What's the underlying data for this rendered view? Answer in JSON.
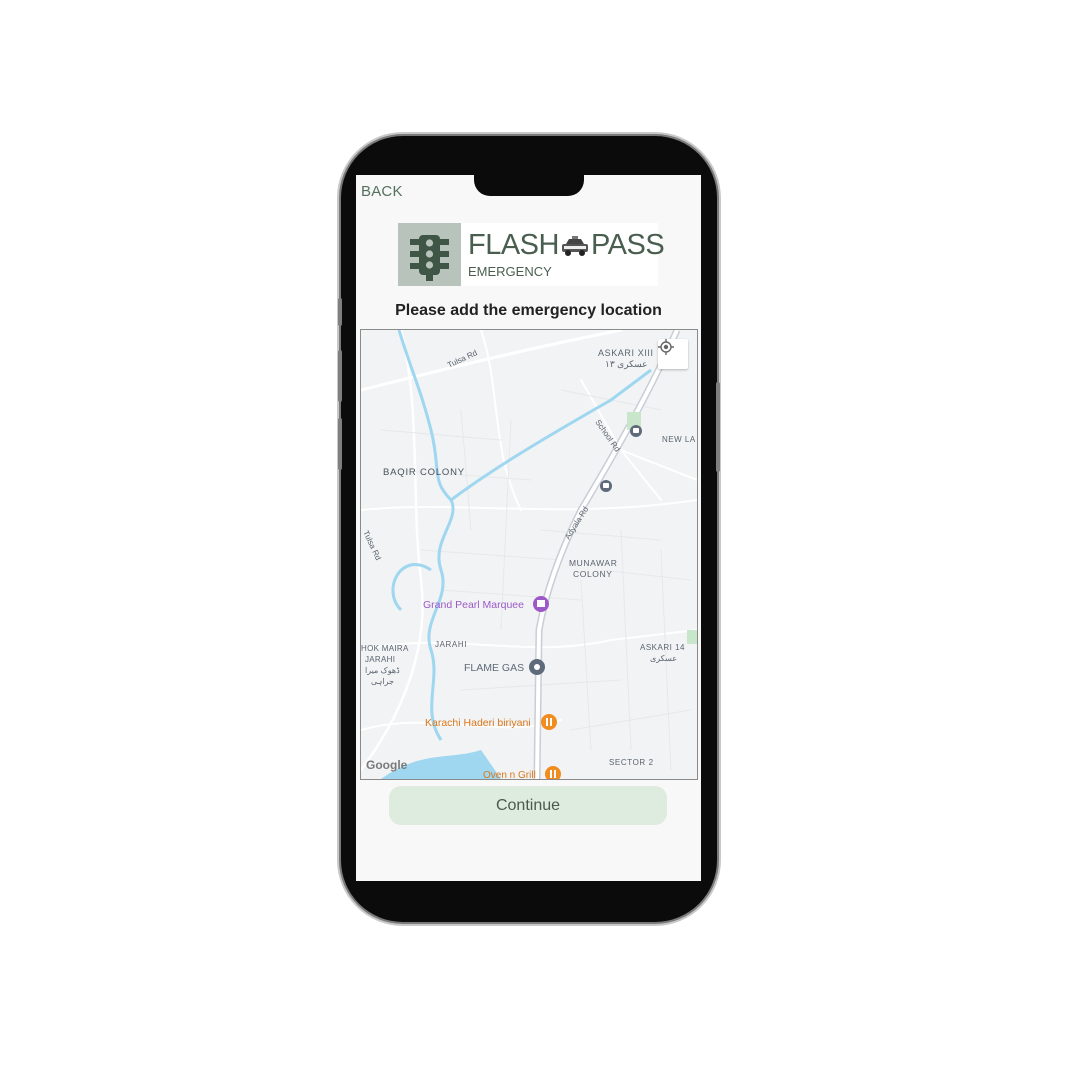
{
  "header": {
    "back_label": "BACK"
  },
  "logo": {
    "title": "FLASH",
    "title_end": "PASS",
    "subtitle": "EMERGENCY"
  },
  "headline": "Please add the emergency location",
  "map": {
    "labels": {
      "askari13": "ASKARI XIII",
      "askari13_urdu": "عسکری ۱۳",
      "tulsa_rd": "Tulsa Rd",
      "tulsa_rd_2": "Tulsa Rd",
      "school_rd": "School Rd",
      "new_la": "NEW LA",
      "baqir_colony": "BAQIR COLONY",
      "adyala_rd": "Adyala Rd",
      "munawar_line1": "MUNAWAR",
      "munawar_line2": "COLONY",
      "grand_pearl": "Grand Pearl Marquee",
      "jarahi": "JARAHI",
      "dhok_maira_1": "HOK MAIRA",
      "dhok_maira_2": "JARAHI",
      "dhok_maira_urdu1": "ڈھوک میرا",
      "dhok_maira_urdu2": "جراہی",
      "flame_gas": "FLAME GAS",
      "askari14": "ASKARI 14",
      "askari14_urdu": "عسکری",
      "karachi_haderi": "Karachi Haderi biriyani",
      "sector2": "SECTOR 2",
      "oven_grill": "Oven n Grill",
      "google": "Google"
    }
  },
  "continue_label": "Continue",
  "colors": {
    "accent": "#4a5e50",
    "button_bg": "#deebdf",
    "water": "#aadaff",
    "poi_purple": "#9c5ac8",
    "poi_orange": "#f28c1e"
  }
}
